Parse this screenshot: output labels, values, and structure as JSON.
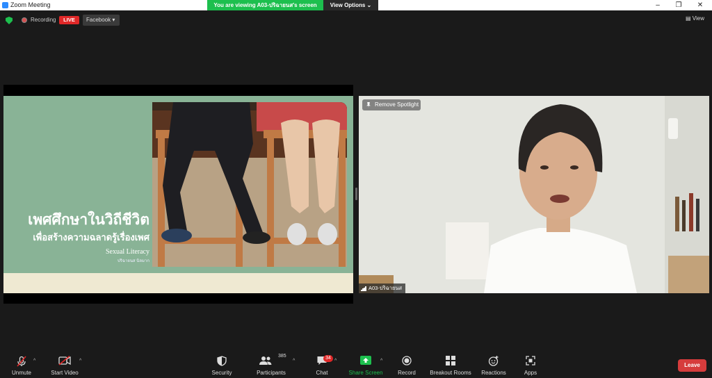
{
  "window": {
    "title": "Zoom Meeting",
    "viewing_banner": "You are viewing A03-ปริฉายนส's screen",
    "view_options": "View Options",
    "controls": [
      "–",
      "❐",
      "✕"
    ]
  },
  "topbar": {
    "recording": "Recording",
    "live": "LIVE",
    "stream_target": "Facebook",
    "view": "View"
  },
  "slide": {
    "title": "เพศศึกษาในวิถีชีวิต",
    "subtitle": "เพื่อสร้างความฉลาดรู้เรื่องเพศ",
    "english_title": "Sexual Literacy",
    "author": "ปริฉายนส นิลมาก"
  },
  "video": {
    "remove_spotlight": "Remove Spotlight",
    "participant_name": "A03-ปริฉายนส"
  },
  "toolbar": {
    "unmute": "Unmute",
    "start_video": "Start Video",
    "security": "Security",
    "participants": "Participants",
    "participants_count": "385",
    "chat": "Chat",
    "chat_badge": "34",
    "share_screen": "Share Screen",
    "record": "Record",
    "breakout_rooms": "Breakout Rooms",
    "reactions": "Reactions",
    "apps": "Apps",
    "leave": "Leave"
  },
  "colors": {
    "accent_green": "#1dbf4e",
    "live_red": "#e02828",
    "leave_red": "#d63c3c",
    "zoom_blue": "#2d8cff"
  }
}
